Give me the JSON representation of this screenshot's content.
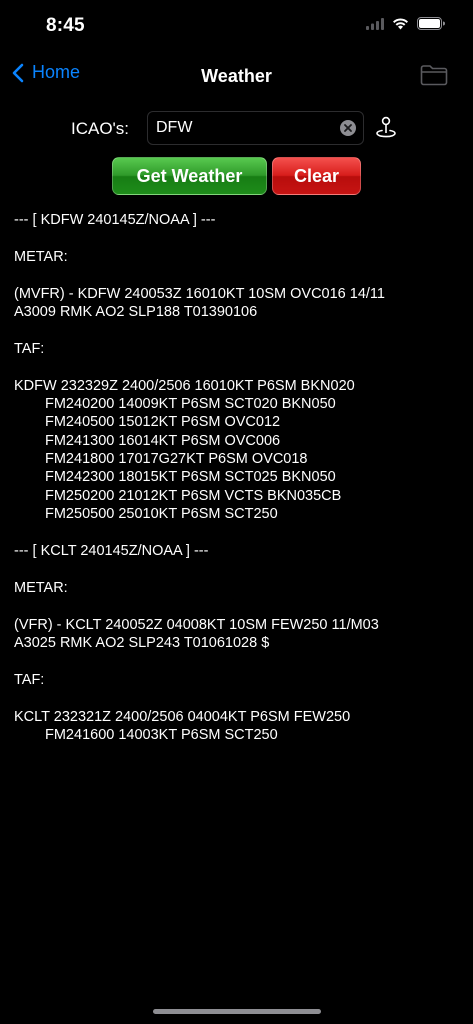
{
  "status": {
    "time": "8:45"
  },
  "nav": {
    "back_label": "Home",
    "title": "Weather",
    "back_icon": "chevron-left-icon",
    "folder_icon": "folder-icon"
  },
  "form": {
    "label": "ICAO's:",
    "value": "DFW",
    "locate_icon": "location-pin-icon"
  },
  "buttons": {
    "get_weather": "Get Weather",
    "clear": "Clear"
  },
  "report": {
    "lines": [
      "--- [ KDFW 240145Z/NOAA ] ---",
      "",
      "METAR:",
      "",
      "(MVFR) - KDFW 240053Z 16010KT 10SM OVC016 14/11",
      "A3009 RMK AO2 SLP188 T01390106",
      "",
      "TAF:",
      "",
      "KDFW 232329Z 2400/2506 16010KT P6SM BKN020",
      "FM240200 14009KT P6SM SCT020 BKN050",
      "FM240500 15012KT P6SM OVC012",
      "FM241300 16014KT P6SM OVC006",
      "FM241800 17017G27KT P6SM OVC018",
      "FM242300 18015KT P6SM SCT025 BKN050",
      "FM250200 21012KT P6SM VCTS BKN035CB",
      "FM250500 25010KT P6SM SCT250",
      "",
      "--- [ KCLT 240145Z/NOAA ] ---",
      "",
      "METAR:",
      "",
      "(VFR) - KCLT 240052Z 04008KT 10SM FEW250 11/M03",
      "A3025 RMK AO2 SLP243 T01061028 $",
      "",
      "TAF:",
      "",
      "KCLT 232321Z 2400/2506 04004KT P6SM FEW250",
      "FM241600 14003KT P6SM SCT250"
    ]
  },
  "colors": {
    "accent": "#0a84ff",
    "get_button": "#2f9a2a",
    "clear_button": "#d81e1c",
    "background": "#000000"
  }
}
